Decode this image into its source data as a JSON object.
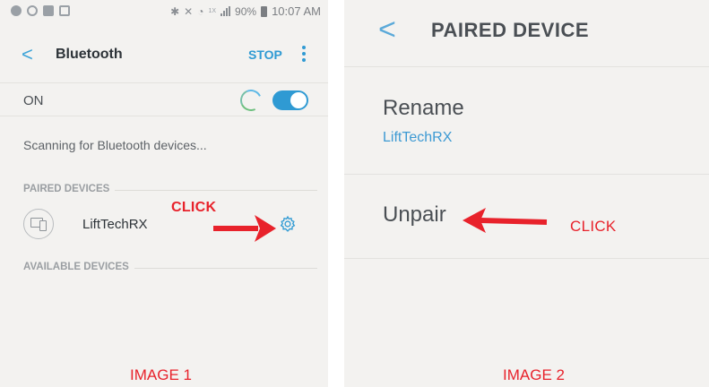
{
  "image1": {
    "status_bar": {
      "signal_text": "1X",
      "battery": "90%",
      "time": "10:07 AM"
    },
    "header": {
      "back_glyph": "<",
      "title": "Bluetooth",
      "stop_label": "STOP"
    },
    "toggle_row": {
      "label": "ON",
      "state": "on"
    },
    "scanning_text": "Scanning for Bluetooth devices...",
    "paired_section": {
      "heading": "PAIRED DEVICES",
      "devices": [
        {
          "name": "LiftTechRX"
        }
      ]
    },
    "available_section": {
      "heading": "AVAILABLE DEVICES"
    },
    "annotation": {
      "text": "CLICK"
    },
    "caption": "IMAGE 1"
  },
  "image2": {
    "header": {
      "back_glyph": "<",
      "title": "PAIRED DEVICE"
    },
    "rename": {
      "label": "Rename",
      "value": "LiftTechRX"
    },
    "unpair": {
      "label": "Unpair"
    },
    "annotation": {
      "text": "CLICK"
    },
    "caption": "IMAGE 2"
  },
  "colors": {
    "accent": "#2f9ad3",
    "annotation": "#e8222b"
  }
}
